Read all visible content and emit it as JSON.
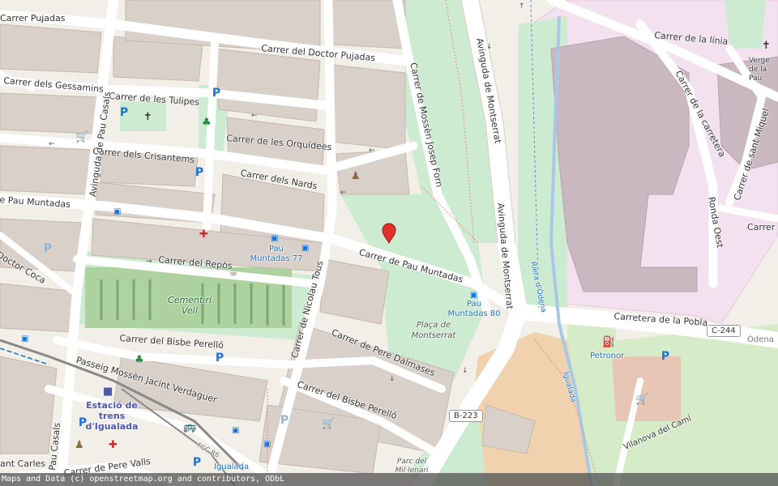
{
  "streets": {
    "pujadas_top": "Carrer Pujadas",
    "doctor_pujadas": "Carrer del Doctor Pujadas",
    "gessamins": "Carrer dels Gessamins",
    "tulipes": "Carrer de les Tulipes",
    "crisantems": "Carrer dels Crisantems",
    "orquidees": "Carrer de les Orquídees",
    "nards": "Carrer dels Nards",
    "pau_casals_north": "Avinguda de Pau Casals",
    "pau_muntadas_west": "e Pau Muntadas",
    "pau_muntadas_east": "Carrer de Pau Muntadas",
    "doctor_coca": "Doctor Coca",
    "repos": "Carrer del Repòs",
    "nicolau_tous": "Carrer de Nicolau Tous",
    "mossen_josep_forn": "Carrer de Mossèn Josep Forn",
    "montserrat_north": "Avinguda de Montserrat",
    "montserrat_south": "Avinguda de Montserrat",
    "linia": "Carrer de la línia",
    "carretera": "Carrer de la carretera",
    "sant_miquel": "Carrer de sant Miquel",
    "ronda_oest": "Ronda Oest",
    "carrer_e": "Carrer",
    "carretera_pobla": "Carretera de la Pobla",
    "bisbe_perello_west": "Carrer del Bisbe Perelló",
    "bisbe_perello_east": "Carrer del Bisbe Perelló",
    "pere_dalmases": "Carrer de Pere Dalmases",
    "passeig_verdaguer": "Passeig Mossèn Jacint Verdaguer",
    "pau_casals_south": "Pau Casals",
    "carles": "ant Carles",
    "pere_valls": "Carrer de Pere Valls",
    "vilanova_cami": "Vilanova del Camí",
    "riera_odena": "Riera d'Òdena",
    "igualada_river": "Igualada",
    "odena": "Òdena",
    "ffcc": "FGC R6"
  },
  "places": {
    "cementiri": "Cementiri Vell",
    "placa_montserrat": "Plaça de Montserrat",
    "parc_mil_lenari": "Parc del Mil·lenari",
    "verge": "Verge de la Pau",
    "estacio": "Estació de trens d'Igualada",
    "petronor": "Petronor",
    "igualada_bottom": "Igualada"
  },
  "bus_stops": {
    "pau_muntadas_77": "Pau Muntadas 77",
    "pau_muntadas_80": "Pau Muntadas 80"
  },
  "shields": {
    "b223": "B-223",
    "c244": "C-244"
  },
  "icons": [
    "parking-icon",
    "church-icon",
    "playground-icon",
    "shop-icon",
    "bus-stop-icon",
    "pharmacy-icon",
    "toilets-icon",
    "fuel-icon",
    "marker-icon",
    "train-icon"
  ],
  "marker_color": "#e0312b",
  "attribution": "Maps and Data (c) openstreetmap.org and contributors, ODbL"
}
